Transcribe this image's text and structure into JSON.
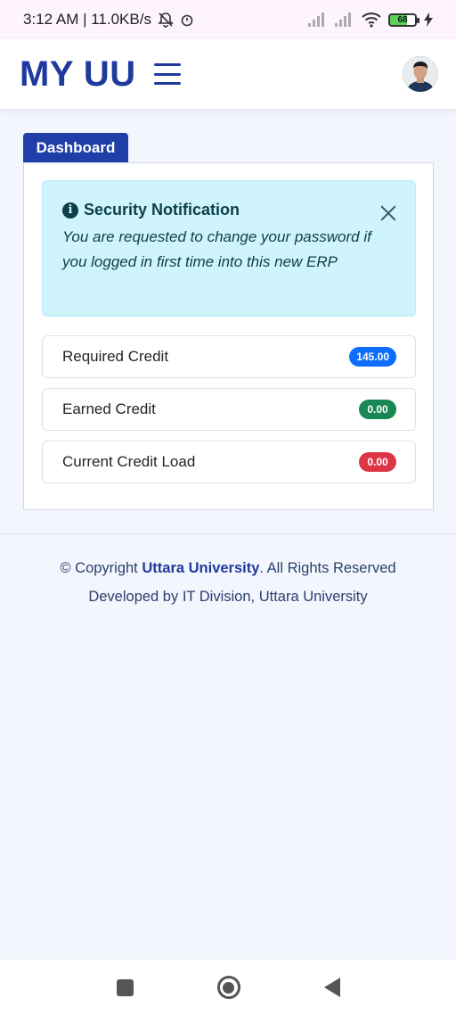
{
  "status_bar": {
    "time_speed": "3:12 AM | 11.0KB/s",
    "battery_level": "68"
  },
  "header": {
    "brand": "MY UU"
  },
  "dashboard": {
    "tab_label": "Dashboard",
    "alert": {
      "title": "Security Notification",
      "message": "You are requested to change your password if you logged in first time into this new ERP"
    },
    "items": [
      {
        "label": "Required Credit",
        "value": "145.00",
        "color": "#0d6efd"
      },
      {
        "label": "Earned Credit",
        "value": "0.00",
        "color": "#198754"
      },
      {
        "label": "Current Credit Load",
        "value": "0.00",
        "color": "#dc3545"
      }
    ]
  },
  "footer": {
    "copyright_prefix": "© Copyright",
    "university": "Uttara University",
    "rights": ". All Rights Reserved",
    "developed_by": "Developed by IT Division, Uttara University"
  }
}
